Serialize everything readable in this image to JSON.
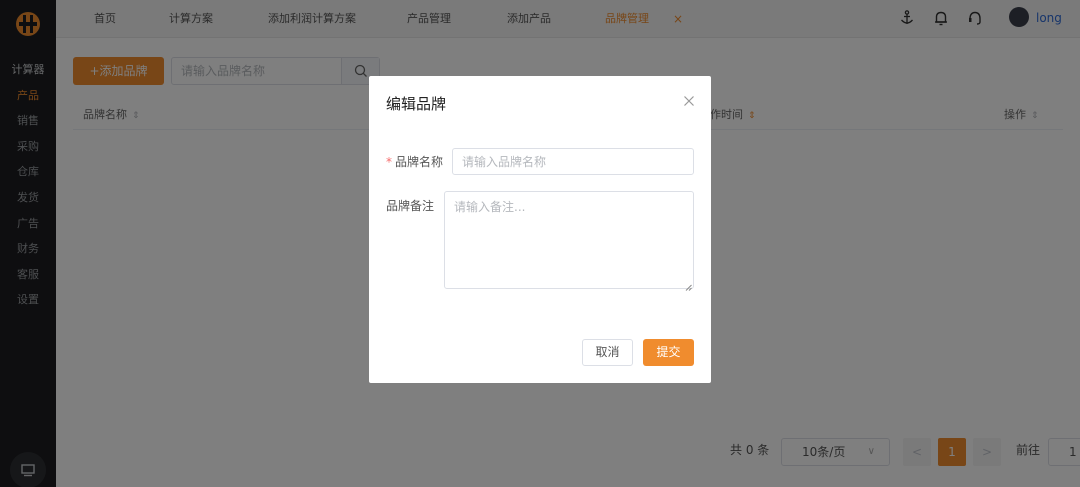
{
  "sidebar": {
    "items": [
      {
        "label": "计算器",
        "state": "head"
      },
      {
        "label": "产品",
        "state": "active"
      },
      {
        "label": "销售",
        "state": ""
      },
      {
        "label": "采购",
        "state": ""
      },
      {
        "label": "仓库",
        "state": ""
      },
      {
        "label": "发货",
        "state": ""
      },
      {
        "label": "广告",
        "state": ""
      },
      {
        "label": "财务",
        "state": ""
      },
      {
        "label": "客服",
        "state": ""
      },
      {
        "label": "设置",
        "state": ""
      }
    ],
    "bottom_icon": "monitor-icon"
  },
  "topbar": {
    "tabs": [
      {
        "label": "首页"
      },
      {
        "label": "计算方案"
      },
      {
        "label": "添加利润计算方案"
      },
      {
        "label": "产品管理"
      },
      {
        "label": "添加产品"
      },
      {
        "label": "品牌管理",
        "active": true
      }
    ],
    "close_glyph": "×",
    "icons": [
      "anchor-icon",
      "bell-icon",
      "headset-icon"
    ],
    "username": "long"
  },
  "toolbar": {
    "add_label": "+添加品牌",
    "search_placeholder": "请输入品牌名称"
  },
  "table": {
    "columns": [
      {
        "label": "品牌名称",
        "sort": "⇕",
        "sorted": false
      },
      {
        "label": "作时间",
        "sort": "⇕",
        "sorted": true
      },
      {
        "label": "操作",
        "sort": "⇕",
        "sorted": false
      }
    ]
  },
  "pagination": {
    "total": "共 0 条",
    "page_size": "10条/页",
    "prev": "<",
    "current": "1",
    "next": ">",
    "goto_label": "前往",
    "goto_value": "1"
  },
  "modal": {
    "title": "编辑品牌",
    "name_label": "品牌名称",
    "name_required": "*",
    "name_placeholder": "请输入品牌名称",
    "note_label": "品牌备注",
    "note_placeholder": "请输入备注...",
    "cancel_label": "取消",
    "submit_label": "提交"
  },
  "colors": {
    "accent": "#f08c2e",
    "sidebar_bg": "#1c1d20",
    "link": "#2f6bd6"
  }
}
